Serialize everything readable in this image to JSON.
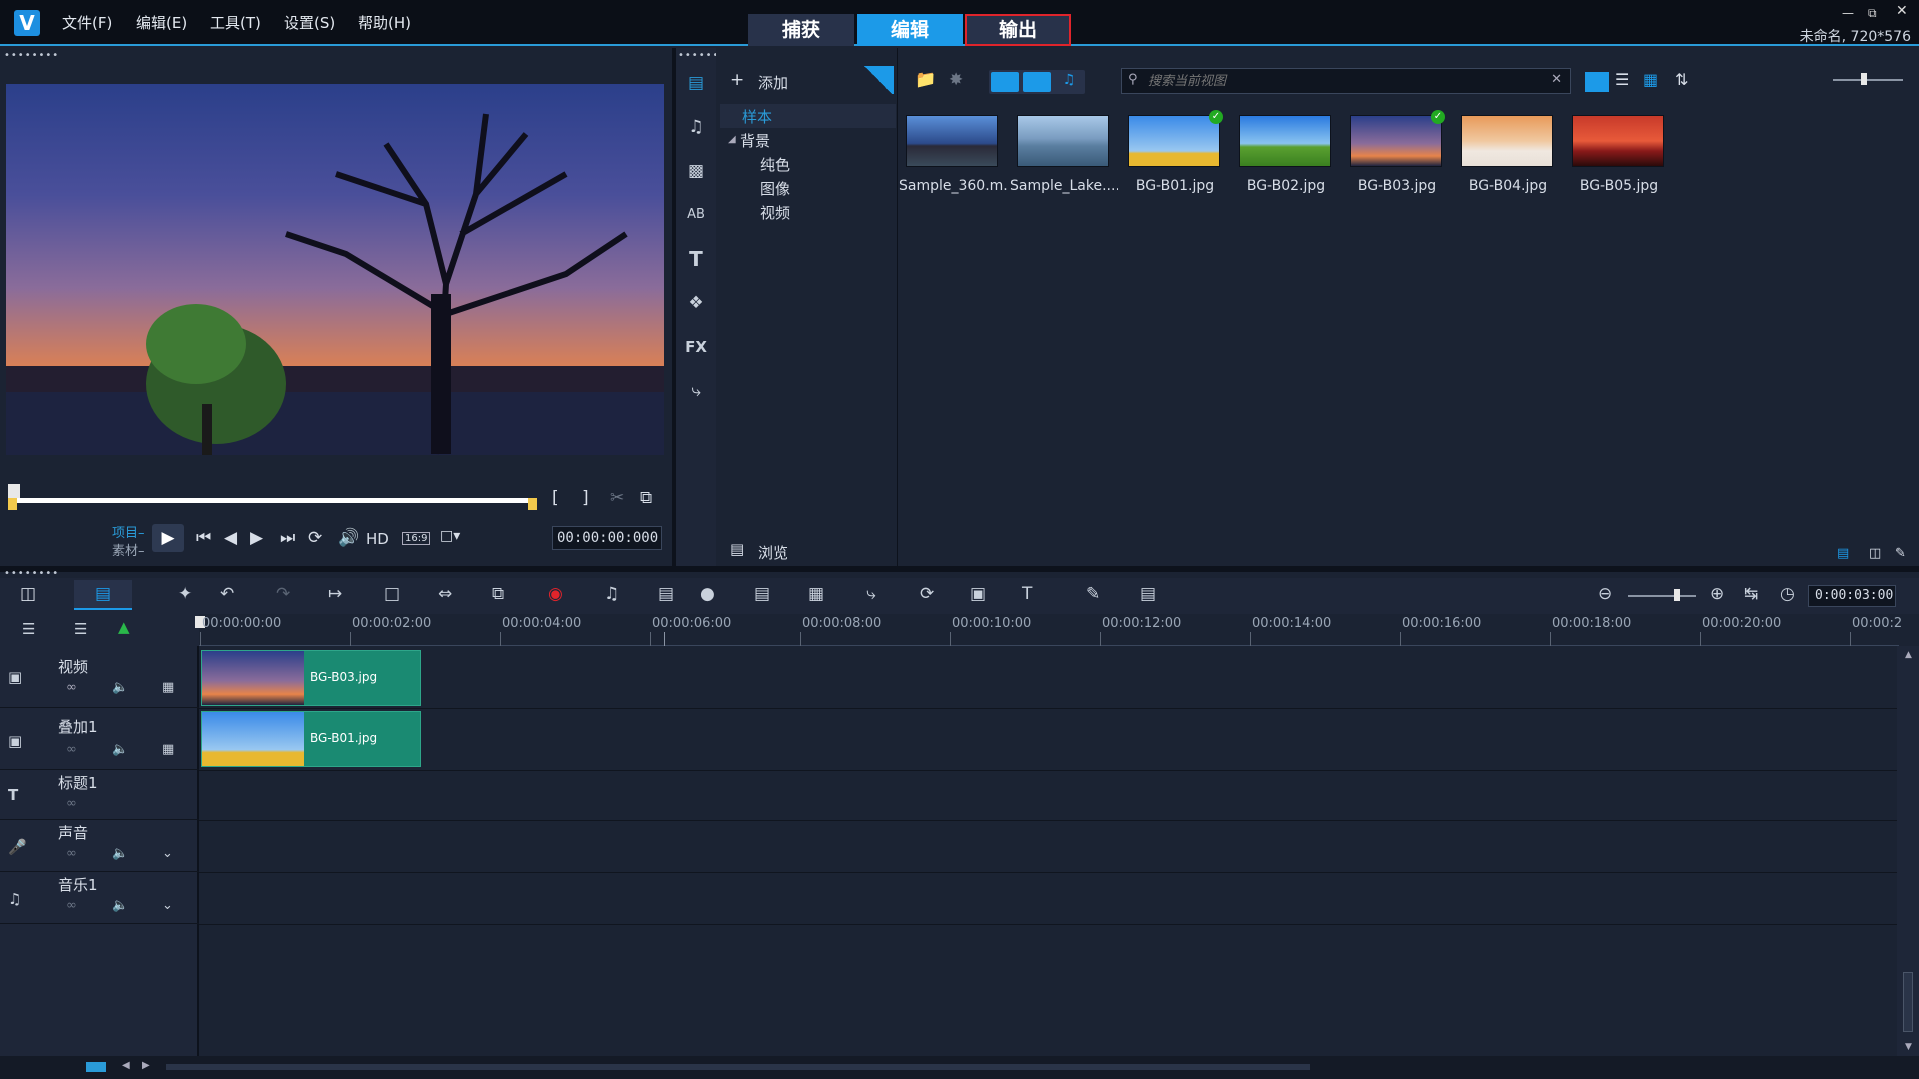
{
  "menu": [
    "文件(F)",
    "编辑(E)",
    "工具(T)",
    "设置(S)",
    "帮助(H)"
  ],
  "modes": {
    "capture": "捕获",
    "edit": "编辑",
    "share": "输出"
  },
  "project_info": "未命名, 720*576",
  "library": {
    "add_label": "添加",
    "tree": {
      "sample": "样本",
      "background": "背景",
      "color": "纯色",
      "image": "图像",
      "video": "视频"
    },
    "browse_label": "浏览",
    "search_placeholder": "搜索当前视图",
    "fx_label": "FX",
    "items": [
      {
        "name": "Sample_360.m...",
        "kind": "video"
      },
      {
        "name": "Sample_Lake....",
        "kind": "video"
      },
      {
        "name": "BG-B01.jpg",
        "kind": "image",
        "used": true
      },
      {
        "name": "BG-B02.jpg",
        "kind": "image"
      },
      {
        "name": "BG-B03.jpg",
        "kind": "image",
        "used": true
      },
      {
        "name": "BG-B04.jpg",
        "kind": "image"
      },
      {
        "name": "BG-B05.jpg",
        "kind": "image"
      }
    ]
  },
  "player": {
    "project_label": "项目",
    "clip_label": "素材",
    "hd_label": "HD",
    "aspect_label": "16:9",
    "timecode": "00:00:00:000"
  },
  "timeline": {
    "duration": "0:00:03:00",
    "ticks": [
      "00:00:00:00",
      "00:00:02:00",
      "00:00:04:00",
      "00:00:06:00",
      "00:00:08:00",
      "00:00:10:00",
      "00:00:12:00",
      "00:00:14:00",
      "00:00:16:00",
      "00:00:18:00",
      "00:00:20:00",
      "00:00:2"
    ],
    "tracks": [
      {
        "name": "视频",
        "clip": "BG-B03.jpg"
      },
      {
        "name": "叠加1",
        "clip": "BG-B01.jpg"
      },
      {
        "name": "标题1",
        "clip": ""
      },
      {
        "name": "声音",
        "clip": ""
      },
      {
        "name": "音乐1",
        "clip": ""
      }
    ]
  }
}
